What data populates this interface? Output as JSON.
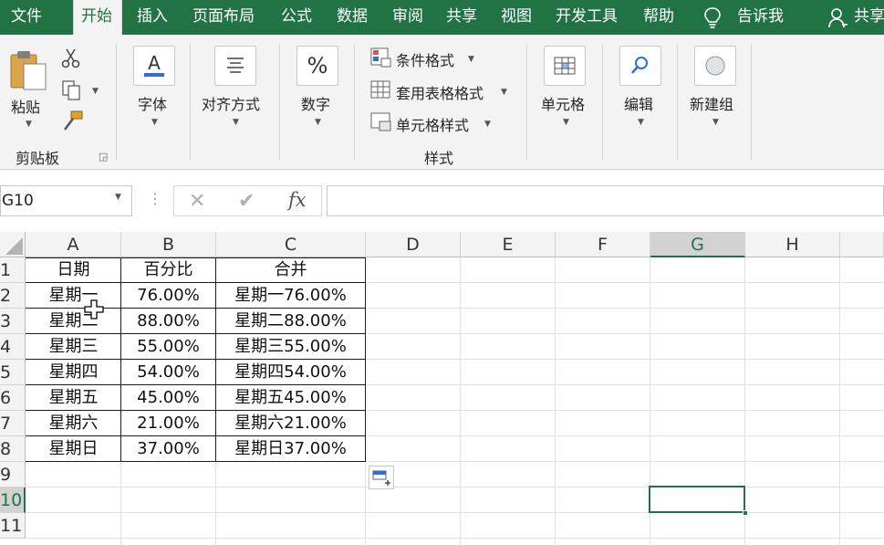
{
  "menu": {
    "tabs": [
      "文件",
      "开始",
      "插入",
      "页面布局",
      "公式",
      "数据",
      "审阅",
      "共享",
      "视图",
      "开发工具",
      "帮助"
    ],
    "tell_me": "告诉我",
    "share": "共享"
  },
  "ribbon": {
    "paste": "粘贴",
    "clipboard": "剪贴板",
    "font": "字体",
    "alignment": "对齐方式",
    "number": "数字",
    "conditional_format": "条件格式",
    "table_format": "套用表格格式",
    "cell_style": "单元格样式",
    "styles": "样式",
    "cells": "单元格",
    "editing": "编辑",
    "new_group": "新建组"
  },
  "formula_bar": {
    "name_box": "G10",
    "fx": "fx",
    "value": ""
  },
  "sheet": {
    "columns": [
      "A",
      "B",
      "C",
      "D",
      "E",
      "F",
      "G",
      "H"
    ],
    "rows": [
      "1",
      "2",
      "3",
      "4",
      "5",
      "6",
      "7",
      "8",
      "9",
      "10",
      "11"
    ],
    "table": [
      [
        "日期",
        "百分比",
        "合并"
      ],
      [
        "星期一",
        "76.00%",
        "星期一76.00%"
      ],
      [
        "星期二",
        "88.00%",
        "星期二88.00%"
      ],
      [
        "星期三",
        "55.00%",
        "星期三55.00%"
      ],
      [
        "星期四",
        "54.00%",
        "星期四54.00%"
      ],
      [
        "星期五",
        "45.00%",
        "星期五45.00%"
      ],
      [
        "星期六",
        "21.00%",
        "星期六21.00%"
      ],
      [
        "星期日",
        "37.00%",
        "星期日37.00%"
      ]
    ],
    "selected_cell": "G10"
  },
  "colors": {
    "accent": "#217346",
    "ribbon_bg": "#f3f3f3",
    "header_bg": "#f3f3f3",
    "gridline": "#e1e1e1"
  }
}
